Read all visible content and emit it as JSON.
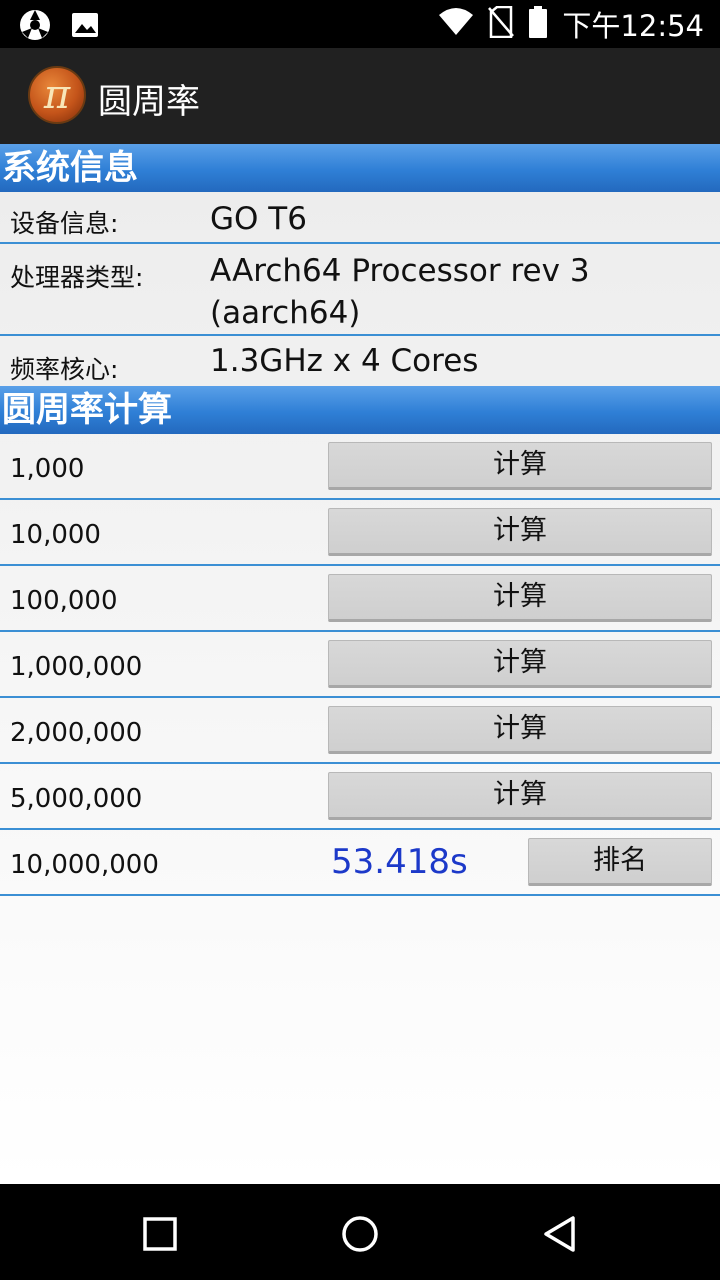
{
  "status_bar": {
    "time": "下午12:54",
    "icons": [
      "sync-icon",
      "image-icon",
      "wifi-icon",
      "no-sim-icon",
      "battery-icon"
    ]
  },
  "app_bar": {
    "logo_glyph": "π",
    "title": "圆周率"
  },
  "system_info": {
    "header": "系统信息",
    "rows": [
      {
        "label": "设备信息:",
        "value": "GO T6"
      },
      {
        "label": "处理器类型:",
        "value_line1": "AArch64 Processor rev 3",
        "value_line2": "(aarch64)"
      },
      {
        "label": "频率核心:",
        "value": "1.3GHz x 4 Cores"
      }
    ]
  },
  "pi_calc": {
    "header": "圆周率计算",
    "calc_label": "计算",
    "rank_label": "排名",
    "rows": [
      {
        "digits": "1,000"
      },
      {
        "digits": "10,000"
      },
      {
        "digits": "100,000"
      },
      {
        "digits": "1,000,000"
      },
      {
        "digits": "2,000,000"
      },
      {
        "digits": "5,000,000"
      },
      {
        "digits": "10,000,000",
        "result": "53.418s"
      }
    ]
  },
  "nav_bar": {
    "buttons": [
      "recents-icon",
      "home-icon",
      "back-icon"
    ]
  },
  "colors": {
    "section_header": "#2f7fd6",
    "divider": "#3b8fd4",
    "result_text": "#1c39c9",
    "app_bar": "#212121"
  }
}
